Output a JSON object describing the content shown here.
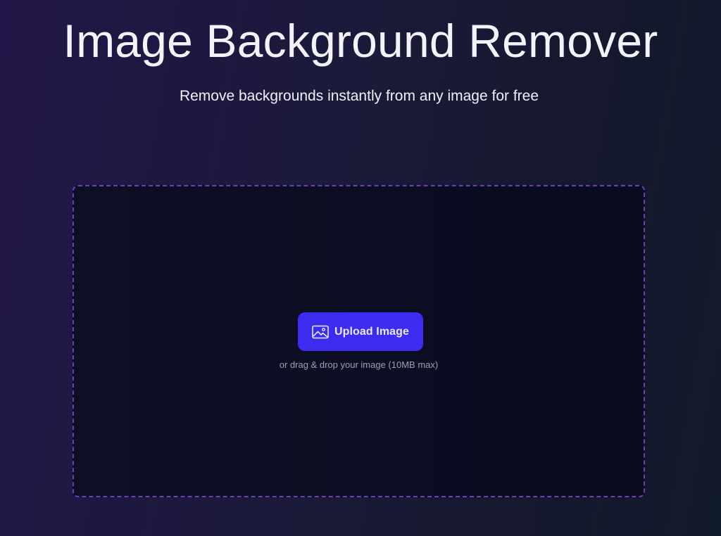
{
  "header": {
    "title": "Image Background Remover",
    "subtitle": "Remove backgrounds instantly from any image for free"
  },
  "upload": {
    "button_label": "Upload Image",
    "button_icon": "image-icon",
    "hint": "or drag & drop your image (10MB max)"
  },
  "colors": {
    "accent": "#3b2cf0",
    "dropzone_border": "#6c3fb8"
  }
}
